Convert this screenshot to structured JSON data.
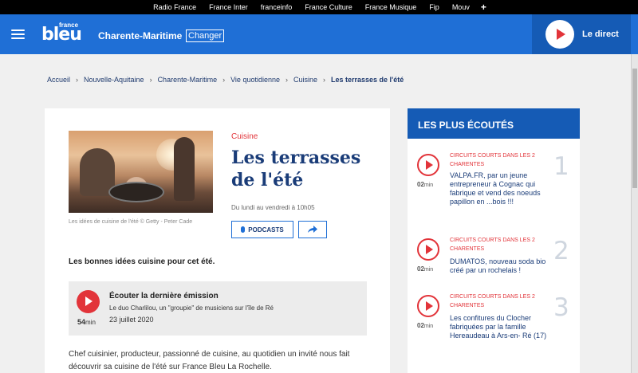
{
  "network": [
    "Radio France",
    "France Inter",
    "franceinfo",
    "France Culture",
    "France Musique",
    "Fip",
    "Mouv"
  ],
  "network_plus": "+",
  "header": {
    "logo_small": "france",
    "logo_big": "bleu",
    "region": "Charente-Maritime",
    "changer": "Changer",
    "live_label": "Le direct"
  },
  "breadcrumb": [
    "Accueil",
    "Nouvelle-Aquitaine",
    "Charente-Maritime",
    "Vie quotidienne",
    "Cuisine",
    "Les terrasses de l'été"
  ],
  "show": {
    "category": "Cuisine",
    "title": "Les terrasses de l'été",
    "schedule": "Du lundi au vendredi à 10h05",
    "caption": "Les idées de cuisine de l'été © Getty - Peter Cade",
    "podcasts_label": "PODCASTS",
    "lead": "Les bonnes idées cuisine pour cet été.",
    "last": {
      "title": "Écouter la dernière émission",
      "subtitle": "Le duo Charlilou, un \"groupie\" de musiciens sur l'île de Ré",
      "date": "23 juillet 2020",
      "duration": "54",
      "duration_unit": "min"
    },
    "body": "Chef cuisinier, producteur, passionné de cuisine, au quotidien un invité nous fait découvrir sa cuisine de l'été sur France Bleu La Rochelle."
  },
  "sidebar": {
    "heading": "LES PLUS ÉCOUTÉS",
    "items": [
      {
        "kicker": "CIRCUITS COURTS DANS LES 2 CHARENTES",
        "text": "VALPA.FR, par un jeune entrepreneur à Cognac qui fabrique et vend des noeuds papillon en ...bois !!!",
        "duration": "02",
        "unit": "min",
        "rank": "1"
      },
      {
        "kicker": "CIRCUITS COURTS DANS LES 2 CHARENTES",
        "text": "DUMATOS, nouveau soda bio créé par un rochelais !",
        "duration": "02",
        "unit": "min",
        "rank": "2"
      },
      {
        "kicker": "CIRCUITS COURTS DANS LES 2 CHARENTES",
        "text": "Les confitures du Clocher fabriquées par la famille Hereaudeau à Ars-en- Ré (17)",
        "duration": "02",
        "unit": "min",
        "rank": "3"
      }
    ]
  },
  "colors": {
    "blue": "#1f6fd6",
    "dark_blue": "#155bb5",
    "red": "#e2343a",
    "navy": "#1a3c78"
  }
}
